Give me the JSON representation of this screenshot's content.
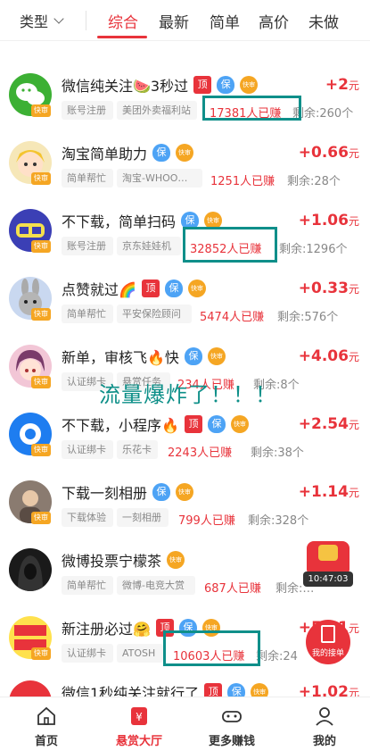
{
  "filter": {
    "type_label": "类型",
    "tabs": [
      "综合",
      "最新",
      "简单",
      "高价",
      "未做"
    ]
  },
  "peek_text": "…  …已赚  剩余:…个",
  "tasks": [
    {
      "title": "微信纯关注🍉3秒过",
      "badges": [
        "顶",
        "保",
        "快审"
      ],
      "tags": [
        "账号注册",
        "美团外卖福利站"
      ],
      "earned": "17381人已赚",
      "remaining": "剩余:260个",
      "price": "+2",
      "unit": "元"
    },
    {
      "title": "淘宝简单助力",
      "badges": [
        "保",
        "快审"
      ],
      "tags": [
        "简单帮忙",
        "淘宝-WHOO…"
      ],
      "earned": "1251人已赚",
      "remaining": "剩余:28个",
      "price": "+0.66",
      "unit": "元"
    },
    {
      "title": "不下载，简单扫码",
      "badges": [
        "保",
        "快审"
      ],
      "tags": [
        "账号注册",
        "京东娃娃机"
      ],
      "earned": "32852人已赚",
      "remaining": "剩余:1296个",
      "price": "+1.06",
      "unit": "元"
    },
    {
      "title": "点赞就过🌈",
      "badges": [
        "顶",
        "保",
        "快审"
      ],
      "tags": [
        "简单帮忙",
        "平安保险顾问"
      ],
      "earned": "5474人已赚",
      "remaining": "剩余:576个",
      "price": "+0.33",
      "unit": "元"
    },
    {
      "title": "新单，审核飞🔥快",
      "badges": [
        "保",
        "快审"
      ],
      "tags": [
        "认证绑卡",
        "悬赏任务"
      ],
      "earned": "234人已赚",
      "remaining": "剩余:8个",
      "price": "+4.06",
      "unit": "元"
    },
    {
      "title": "不下载，小程序🔥",
      "badges": [
        "顶",
        "保",
        "快审"
      ],
      "tags": [
        "认证绑卡",
        "乐花卡"
      ],
      "earned": "2243人已赚",
      "remaining": "剩余:38个",
      "price": "+2.54",
      "unit": "元"
    },
    {
      "title": "下载一刻相册",
      "badges": [
        "保",
        "快审"
      ],
      "tags": [
        "下载体验",
        "一刻相册"
      ],
      "earned": "799人已赚",
      "remaining": "剩余:328个",
      "price": "+1.14",
      "unit": "元"
    },
    {
      "title": "微博投票宁檬茶",
      "badges": [
        "快审"
      ],
      "tags": [
        "简单帮忙",
        "微博-电竞大赏"
      ],
      "earned": "687人已赚",
      "remaining": "剩余:…",
      "price": "+…",
      "unit": "元"
    },
    {
      "title": "新注册必过🤗",
      "badges": [
        "顶",
        "保",
        "快审"
      ],
      "tags": [
        "认证绑卡",
        "ATOSH"
      ],
      "earned": "10603人已赚",
      "remaining": "剩余:24",
      "price": "+5.01",
      "unit": "元"
    },
    {
      "title": "微信1秒纯关注就行了",
      "badges": [
        "顶",
        "保",
        "快审"
      ],
      "tags": [],
      "earned": "",
      "remaining": "",
      "price": "+1.02",
      "unit": "元"
    }
  ],
  "avatar_tag": "快审",
  "annotation": "流量爆炸了！！！",
  "floating": {
    "timer": "10:47:03",
    "my_orders": "我的接单"
  },
  "bottom_nav": [
    "首页",
    "悬赏大厅",
    "更多赚钱",
    "我的"
  ],
  "colors": {
    "accent": "#e8333b",
    "highlight": "#0f8f8a",
    "vip": "#4da3f5",
    "fast": "#f5a623"
  }
}
